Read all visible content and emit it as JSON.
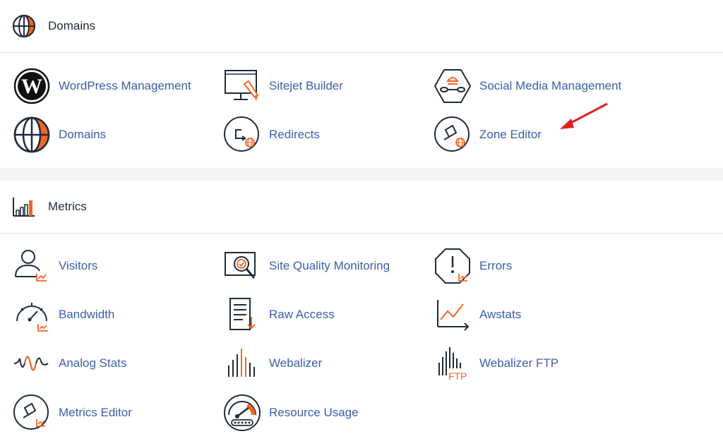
{
  "colors": {
    "accent": "#f26522",
    "link": "#3b5ea8",
    "heading": "#1f2b3a",
    "arrow": "#e0201e"
  },
  "domains_section": {
    "title": "Domains",
    "icon": "globe-icon",
    "items": [
      {
        "label": "WordPress Management",
        "icon": "wordpress-icon"
      },
      {
        "label": "Sitejet Builder",
        "icon": "sitejet-monitor-icon"
      },
      {
        "label": "Social Media Management",
        "icon": "social-media-icon"
      },
      {
        "label": "Domains",
        "icon": "globe-icon"
      },
      {
        "label": "Redirects",
        "icon": "redirect-icon"
      },
      {
        "label": "Zone Editor",
        "icon": "zone-editor-icon"
      }
    ]
  },
  "metrics_section": {
    "title": "Metrics",
    "icon": "bar-chart-icon",
    "items": [
      {
        "label": "Visitors",
        "icon": "visitors-icon"
      },
      {
        "label": "Site Quality Monitoring",
        "icon": "site-quality-icon"
      },
      {
        "label": "Errors",
        "icon": "errors-icon"
      },
      {
        "label": "Bandwidth",
        "icon": "bandwidth-gauge-icon"
      },
      {
        "label": "Raw Access",
        "icon": "raw-access-icon"
      },
      {
        "label": "Awstats",
        "icon": "awstats-icon"
      },
      {
        "label": "Analog Stats",
        "icon": "analog-stats-icon"
      },
      {
        "label": "Webalizer",
        "icon": "webalizer-icon"
      },
      {
        "label": "Webalizer FTP",
        "icon": "webalizer-ftp-icon"
      },
      {
        "label": "Metrics Editor",
        "icon": "metrics-editor-icon"
      },
      {
        "label": "Resource Usage",
        "icon": "resource-usage-icon"
      }
    ],
    "ftp_text": "FTP"
  }
}
